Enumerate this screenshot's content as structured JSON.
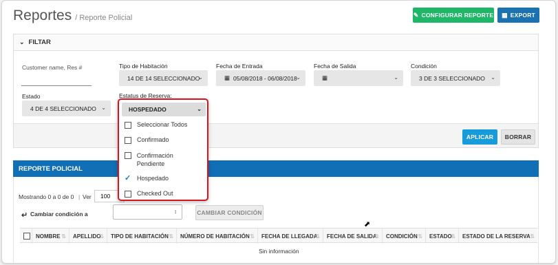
{
  "header": {
    "title": "Reportes",
    "breadcrumb": "/ Reporte Policial",
    "configure_label": "CONFIGURAR REPORTE",
    "export_label": "EXPORT"
  },
  "filter": {
    "title": "FILTAR",
    "customer_placeholder": "Customer name, Res #",
    "room_type": {
      "label": "Tipo de Habitación",
      "value": "14 DE 14 SELECCIONADO"
    },
    "check_in": {
      "label": "Fecha de Entrada",
      "value": "05/08/2018 - 06/08/2018"
    },
    "check_out": {
      "label": "Fecha de Salida",
      "value": ""
    },
    "condition": {
      "label": "Condición",
      "value": "3 DE 3 SELECCIONADO"
    },
    "state": {
      "label": "Estado",
      "value": "4 DE 4 SELECCIONADO"
    },
    "reservation_status": {
      "label": "Estatus de Reserva:",
      "value": "HOSPEDADO",
      "options": [
        {
          "label": "Seleccionar Todos",
          "checked": false
        },
        {
          "label": "Confirmado",
          "checked": false
        },
        {
          "label": "Confirmación Pendiente",
          "checked": false
        },
        {
          "label": "Hospedado",
          "checked": true
        },
        {
          "label": "Checked Out",
          "checked": false
        }
      ]
    },
    "apply_label": "APLICAR",
    "clear_label": "BORRAR"
  },
  "report": {
    "title": "REPORTE POLICIAL",
    "showing": "Mostrando 0 a 0 de 0",
    "view_label": "Ver",
    "page_size": "100",
    "change_condition_label": "Cambiar condición a",
    "change_condition_button": "CAMBIAR CONDICIÓN",
    "columns": [
      "NOMBRE",
      "APELLIDO",
      "TIPO DE HABITACIÓN",
      "NÚMERO DE HABITACIÓN",
      "FECHA DE LLEGADA",
      "FECHA DE SALIDA",
      "CONDICIÓN",
      "ESTADO",
      "ESTADO DE LA RESERVA"
    ],
    "empty_text": "Sin información"
  },
  "colors": {
    "green": "#1eb768",
    "blue": "#1a72b0",
    "report_head": "#1170b5",
    "highlight": "#d9141f"
  }
}
